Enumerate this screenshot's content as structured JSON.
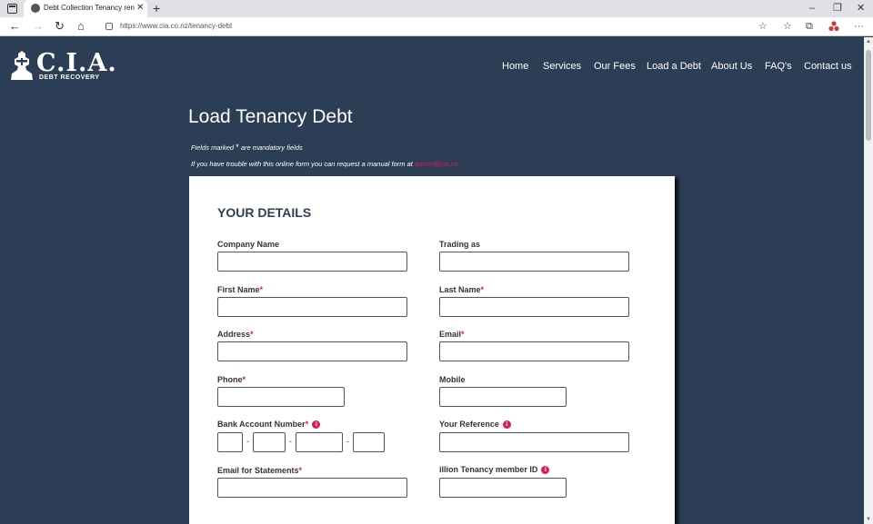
{
  "browser": {
    "tab_title": "Debt Collection Tenancy rent an",
    "url": "https://www.cia.co.nz/tenancy-debt",
    "close_glyph": "✕",
    "new_tab_glyph": "+",
    "minimize_glyph": "–",
    "restore_glyph": "❐",
    "win_close_glyph": "✕",
    "back_glyph": "←",
    "forward_glyph": "→",
    "refresh_glyph": "↻",
    "home_glyph": "⌂",
    "favorites_glyph": "☆",
    "collections_glyph": "☆",
    "tabs_glyph": "⧉",
    "more_glyph": "···"
  },
  "logo": {
    "text": "C.I.A.",
    "subtitle": "DEBT RECOVERY"
  },
  "nav": {
    "home": "Home",
    "services": "Services",
    "our_fees": "Our Fees",
    "load_debt": "Load a Debt",
    "about": "About Us",
    "faqs": "FAQ's",
    "contact": "Contact us"
  },
  "page": {
    "title": "Load Tenancy Debt",
    "mandatory_prefix": "Fields marked",
    "mandatory_star": "*",
    "mandatory_suffix": "are mandatory fields",
    "trouble_text": "If you have trouble with this online form you can request a manual form at",
    "email_link": "admin@cia.nz"
  },
  "form": {
    "section_title": "YOUR DETAILS",
    "required_mark": "*",
    "info_glyph": "i",
    "dash": "-",
    "company_name": "Company Name",
    "trading_as": "Trading as",
    "first_name": "First Name",
    "last_name": "Last Name",
    "address": "Address",
    "email": "Email",
    "phone": "Phone",
    "mobile": "Mobile",
    "bank_account": "Bank Account Number",
    "your_reference": "Your Reference",
    "email_statements": "Email for Statements",
    "illion_id": "illion Tenancy member ID"
  }
}
